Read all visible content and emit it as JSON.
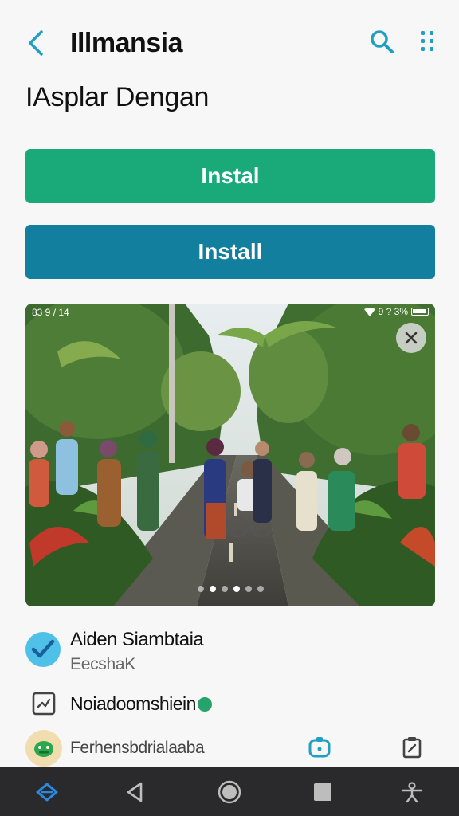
{
  "header": {
    "title": "Illmansia",
    "back_icon": "chevron-left-icon",
    "search_icon": "search-icon",
    "more_icon": "more-vertical-icon",
    "accent_color": "#1f9fc4"
  },
  "subtitle": "IAsplar Dengan",
  "buttons": {
    "primary_label": "Instal",
    "primary_color": "#1aaa7a",
    "secondary_label": "Install",
    "secondary_color": "#137f9f"
  },
  "gallery": {
    "status_left": "83 9 / 14",
    "status_right": "9 ? 3%",
    "close_icon": "close-icon",
    "dots_total": 6,
    "dots_active": 2
  },
  "info": {
    "row1_title": "Aiden Siambtaia",
    "row1_subtitle": "EecshаK",
    "row2_title": "Noiadoomshiein",
    "row3_title": "Ferhensbdrialaaba"
  },
  "nav": {
    "home_icon": "diamond-icon",
    "back_icon": "triangle-back-icon",
    "circle_icon": "circle-home-icon",
    "square_icon": "square-recents-icon",
    "accessibility_icon": "accessibility-icon"
  }
}
